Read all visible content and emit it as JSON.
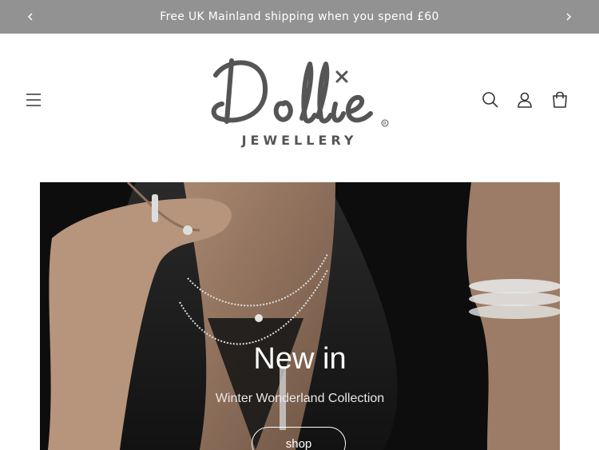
{
  "announcement": {
    "text": "Free UK Mainland shipping when you spend £60",
    "prev_icon": "chevron-left-icon",
    "next_icon": "chevron-right-icon"
  },
  "header": {
    "logo_wordmark": "Dollie",
    "logo_tagline": "JEWELLERY",
    "icons": [
      "menu-icon",
      "search-icon",
      "account-icon",
      "cart-icon"
    ]
  },
  "hero": {
    "title": "New in",
    "subtitle": "Winter Wonderland Collection",
    "button_label": "shop"
  }
}
